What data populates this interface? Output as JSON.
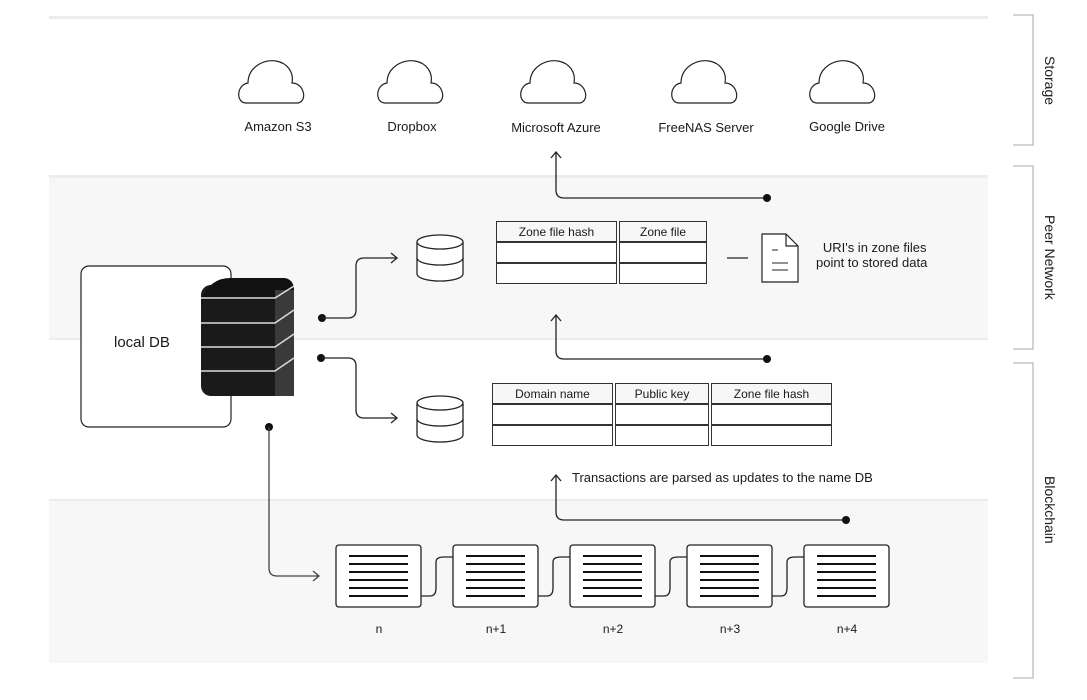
{
  "sections": [
    {
      "id": "storage",
      "label": "Storage"
    },
    {
      "id": "peer",
      "label": "Peer Network"
    },
    {
      "id": "blockchain",
      "label": "Blockchain"
    }
  ],
  "storage_providers": [
    {
      "label": "Amazon S3",
      "icon": "cloud-icon"
    },
    {
      "label": "Dropbox",
      "icon": "cloud-icon"
    },
    {
      "label": "Microsoft Azure",
      "icon": "cloud-icon"
    },
    {
      "label": "FreeNAS Server",
      "icon": "cloud-icon"
    },
    {
      "label": "Google Drive",
      "icon": "cloud-icon"
    }
  ],
  "local_db": {
    "label": "local DB",
    "icon": "server-stack-icon"
  },
  "zone_table": {
    "headers": [
      "Zone file hash",
      "Zone file"
    ],
    "rows": [
      [
        "",
        ""
      ],
      [
        "",
        ""
      ]
    ]
  },
  "zone_note": {
    "line1": "URI's in zone files",
    "line2": "point to stored data",
    "icon": "document-icon"
  },
  "name_table": {
    "headers": [
      "Domain name",
      "Public key",
      "Zone file hash"
    ],
    "rows": [
      [
        "",
        "",
        ""
      ],
      [
        "",
        "",
        ""
      ]
    ]
  },
  "tx_note": "Transactions are parsed as updates to the name DB",
  "blocks": [
    {
      "label": "n"
    },
    {
      "label": "n+1"
    },
    {
      "label": "n+2"
    },
    {
      "label": "n+3"
    },
    {
      "label": "n+4"
    }
  ]
}
